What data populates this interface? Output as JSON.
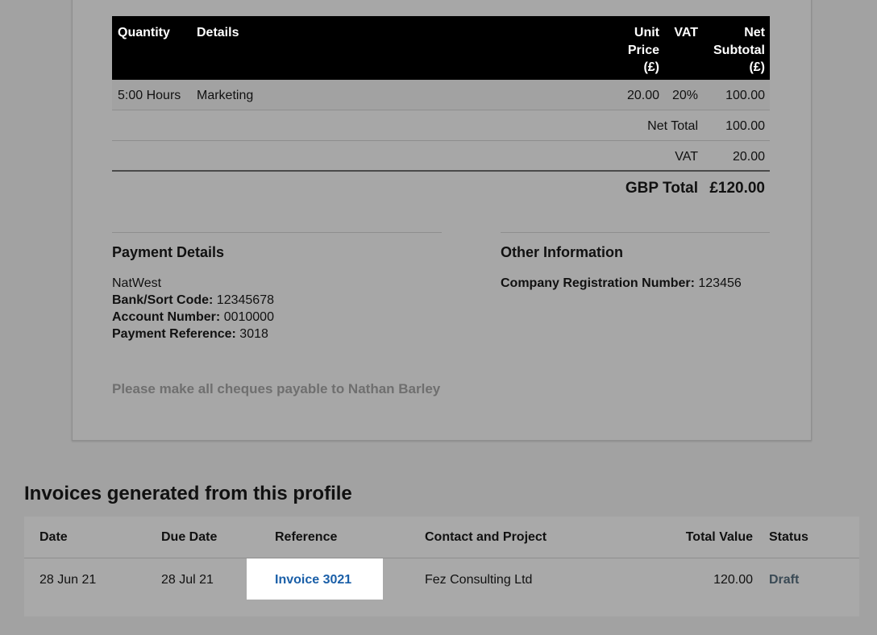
{
  "invoice_preview": {
    "items_table": {
      "headers": {
        "quantity": "Quantity",
        "details": "Details",
        "unit_price": [
          "Unit",
          "Price",
          "(£)"
        ],
        "vat": "VAT",
        "net_subtotal": [
          "Net",
          "Subtotal",
          "(£)"
        ]
      },
      "rows": [
        {
          "quantity": "5:00 Hours",
          "details": "Marketing",
          "unit_price": "20.00",
          "vat": "20%",
          "net_subtotal": "100.00"
        }
      ]
    },
    "totals": {
      "net_total_label": "Net Total",
      "net_total_value": "100.00",
      "vat_label": "VAT",
      "vat_value": "20.00",
      "gbp_total_label": "GBP Total",
      "gbp_total_value": "£120.00"
    },
    "payment_details": {
      "title": "Payment Details",
      "bank": "NatWest",
      "sort_code_label": "Bank/Sort Code:",
      "sort_code": "12345678",
      "account_number_label": "Account Number:",
      "account_number": "0010000",
      "payment_reference_label": "Payment Reference:",
      "payment_reference": "3018"
    },
    "other_information": {
      "title": "Other Information",
      "company_reg_label": "Company Registration Number:",
      "company_reg_value": "123456"
    },
    "cheque_note": "Please make all cheques payable to Nathan Barley"
  },
  "generated_invoices": {
    "heading": "Invoices generated from this profile",
    "columns": {
      "date": "Date",
      "due_date": "Due Date",
      "reference": "Reference",
      "contact_project": "Contact and Project",
      "total_value": "Total Value",
      "status": "Status"
    },
    "rows": [
      {
        "date": "28 Jun 21",
        "due_date": "28 Jul 21",
        "reference": "Invoice 3021",
        "contact_project": "Fez Consulting Ltd",
        "total_value": "120.00",
        "status": "Draft"
      }
    ]
  }
}
